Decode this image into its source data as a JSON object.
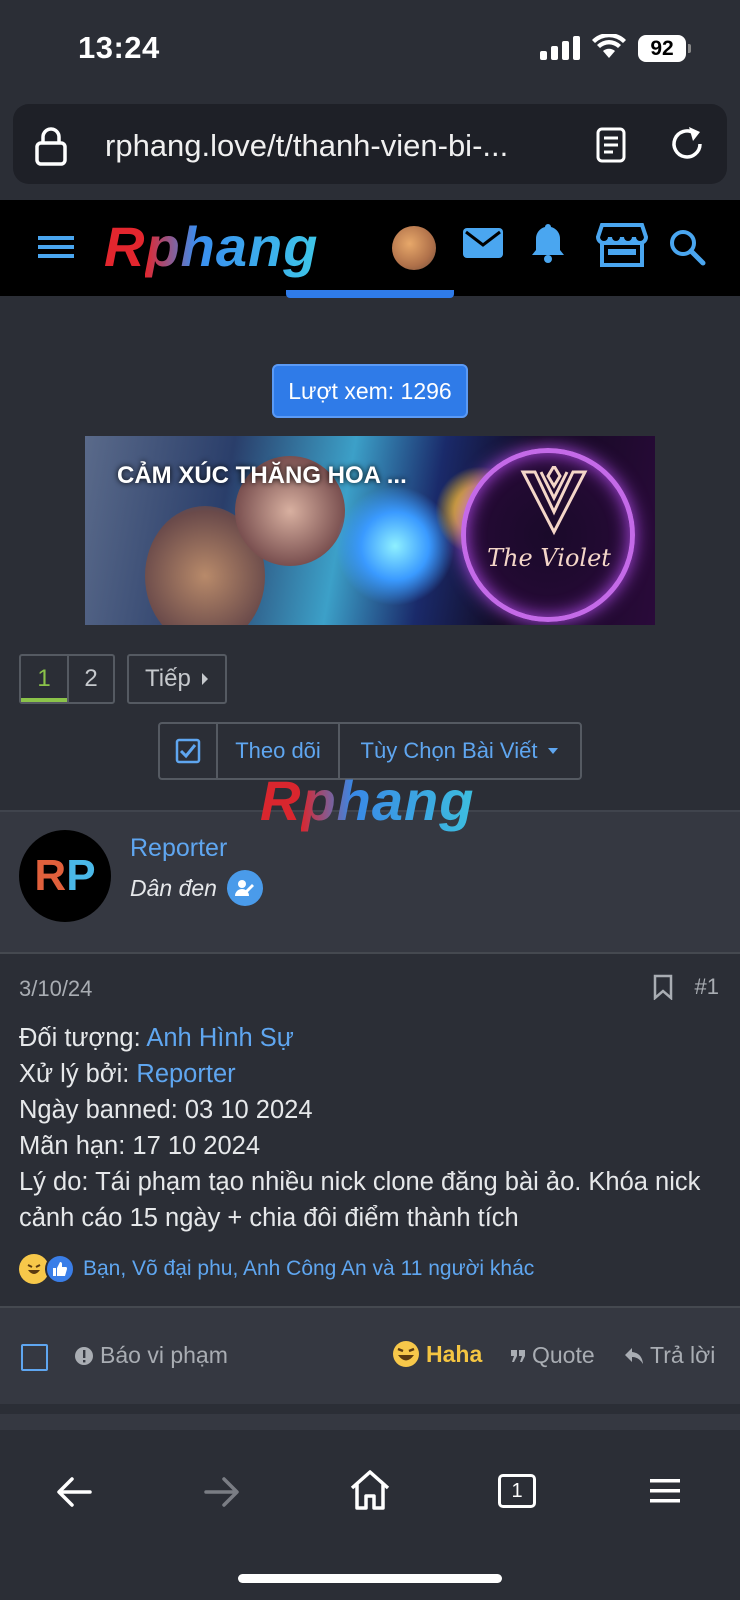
{
  "status_bar": {
    "time": "13:24",
    "battery": "92"
  },
  "browser": {
    "url": "rphang.love/t/thanh-vien-bi-..."
  },
  "site": {
    "logo_first": "R",
    "logo_rest": "phang"
  },
  "thread": {
    "views_label": "Lượt xem: 1296",
    "banner_caption": "CẢM XÚC THĂNG HOA ...",
    "banner_brand": "The Violet",
    "pagination": {
      "pages": [
        "1",
        "2"
      ],
      "current": "1",
      "next_label": "Tiếp"
    },
    "follow_label": "Theo dõi",
    "options_label": "Tùy Chọn Bài Viết",
    "watermark_first": "R",
    "watermark_rest": "phang"
  },
  "post": {
    "author": "Reporter",
    "author_initials_1": "R",
    "author_initials_2": "P",
    "role": "Dân đen",
    "date": "3/10/24",
    "number": "#1",
    "lines": {
      "target_label": "Đối tượng: ",
      "target_value": "Anh Hình Sự",
      "handler_label": "Xử lý bởi: ",
      "handler_value": "Reporter",
      "banned_date": "Ngày banned: 03 10 2024",
      "expiry": "Mãn hạn: 17 10 2024",
      "reason": "Lý do: Tái phạm tạo nhiều nick clone đăng bài ảo. Khóa nick cảnh cáo 15 ngày + chia đôi điểm thành tích"
    },
    "reactions_text": "Bạn, Võ đại phu, Anh Công An và 11 người khác",
    "footer": {
      "report": "Báo vi phạm",
      "haha": "Haha",
      "quote": "Quote",
      "reply": "Trả lời"
    }
  },
  "colors": {
    "accent": "#2f7be8",
    "link": "#5fa6f0",
    "page_current": "#8bc34a",
    "haha": "#f4c542"
  },
  "icons": [
    "lock-icon",
    "reader-icon",
    "reload-icon",
    "menu-icon",
    "mail-icon",
    "bell-icon",
    "store-icon",
    "search-icon",
    "checkbox-icon",
    "caret-down-icon",
    "edit-badge-icon",
    "bookmark-icon",
    "warning-icon",
    "laugh-emoji-icon",
    "like-icon",
    "quote-icon",
    "reply-icon",
    "back-icon",
    "forward-icon",
    "home-icon",
    "tabs-icon",
    "hamburger-icon"
  ],
  "toolbar": {
    "tab_count": "1"
  }
}
